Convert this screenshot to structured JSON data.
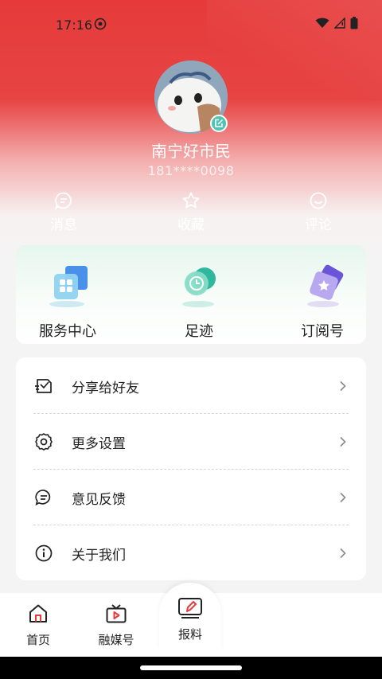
{
  "status_bar": {
    "time": "17:16"
  },
  "profile": {
    "username": "南宁好市民",
    "phone": "181****0098"
  },
  "quick_actions": [
    {
      "label": "消息",
      "icon": "message-icon"
    },
    {
      "label": "收藏",
      "icon": "star-icon"
    },
    {
      "label": "评论",
      "icon": "comment-icon"
    }
  ],
  "services": [
    {
      "label": "服务中心",
      "icon": "service-center-icon"
    },
    {
      "label": "足迹",
      "icon": "footprint-icon"
    },
    {
      "label": "订阅号",
      "icon": "subscription-icon"
    }
  ],
  "menu": [
    {
      "label": "分享给好友",
      "icon": "share-icon"
    },
    {
      "label": "更多设置",
      "icon": "settings-icon"
    },
    {
      "label": "意见反馈",
      "icon": "feedback-icon"
    },
    {
      "label": "关于我们",
      "icon": "info-icon"
    }
  ],
  "tabs": [
    {
      "label": "首页",
      "icon": "home-icon"
    },
    {
      "label": "融媒号",
      "icon": "tv-icon"
    },
    {
      "label": "报料",
      "icon": "report-icon"
    }
  ],
  "colors": {
    "brand_red": "#e63a3a",
    "accent_teal": "#4fc4b3"
  }
}
